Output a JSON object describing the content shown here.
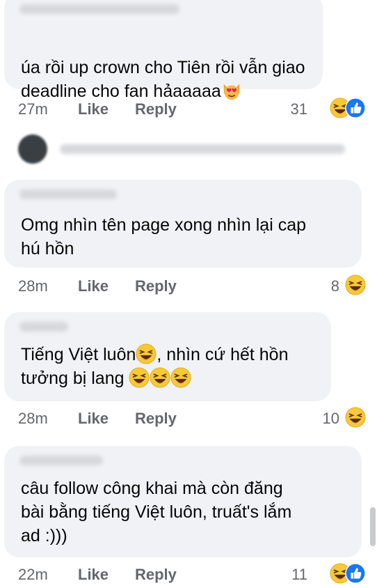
{
  "comments": [
    {
      "text": "úa rồi up crown cho Tiên rồi vẫn giao\ndeadline cho fan hảaaaaa",
      "time": "27m",
      "like": "Like",
      "reply": "Reply",
      "count": "31",
      "reactions": [
        "haha-icon",
        "like-icon"
      ]
    },
    {
      "text": "Omg nhìn tên page xong nhìn lại cap\nhú hồn",
      "time": "28m",
      "like": "Like",
      "reply": "Reply",
      "count": "8",
      "reactions": [
        "haha-icon"
      ]
    },
    {
      "text_line1_before": "Tiếng Việt luôn",
      "text_line1_after": ", nhìn cứ hết hồn",
      "text_line2": "tưởng bị lang ",
      "time": "28m",
      "like": "Like",
      "reply": "Reply",
      "count": "10",
      "reactions": [
        "haha-icon"
      ]
    },
    {
      "text": "câu follow công khai mà còn đăng\nbài bằng tiếng Việt luôn, truất's lắm\nad :)))",
      "time": "22m",
      "like": "Like",
      "reply": "Reply",
      "count": "11",
      "reactions": [
        "haha-icon",
        "like-icon"
      ]
    }
  ],
  "colors": {
    "bubble": "#f0f2f5",
    "meta": "#65676b",
    "text": "#050505",
    "like_blue": "#1877f2",
    "haha_yellow": "#f7c938"
  }
}
